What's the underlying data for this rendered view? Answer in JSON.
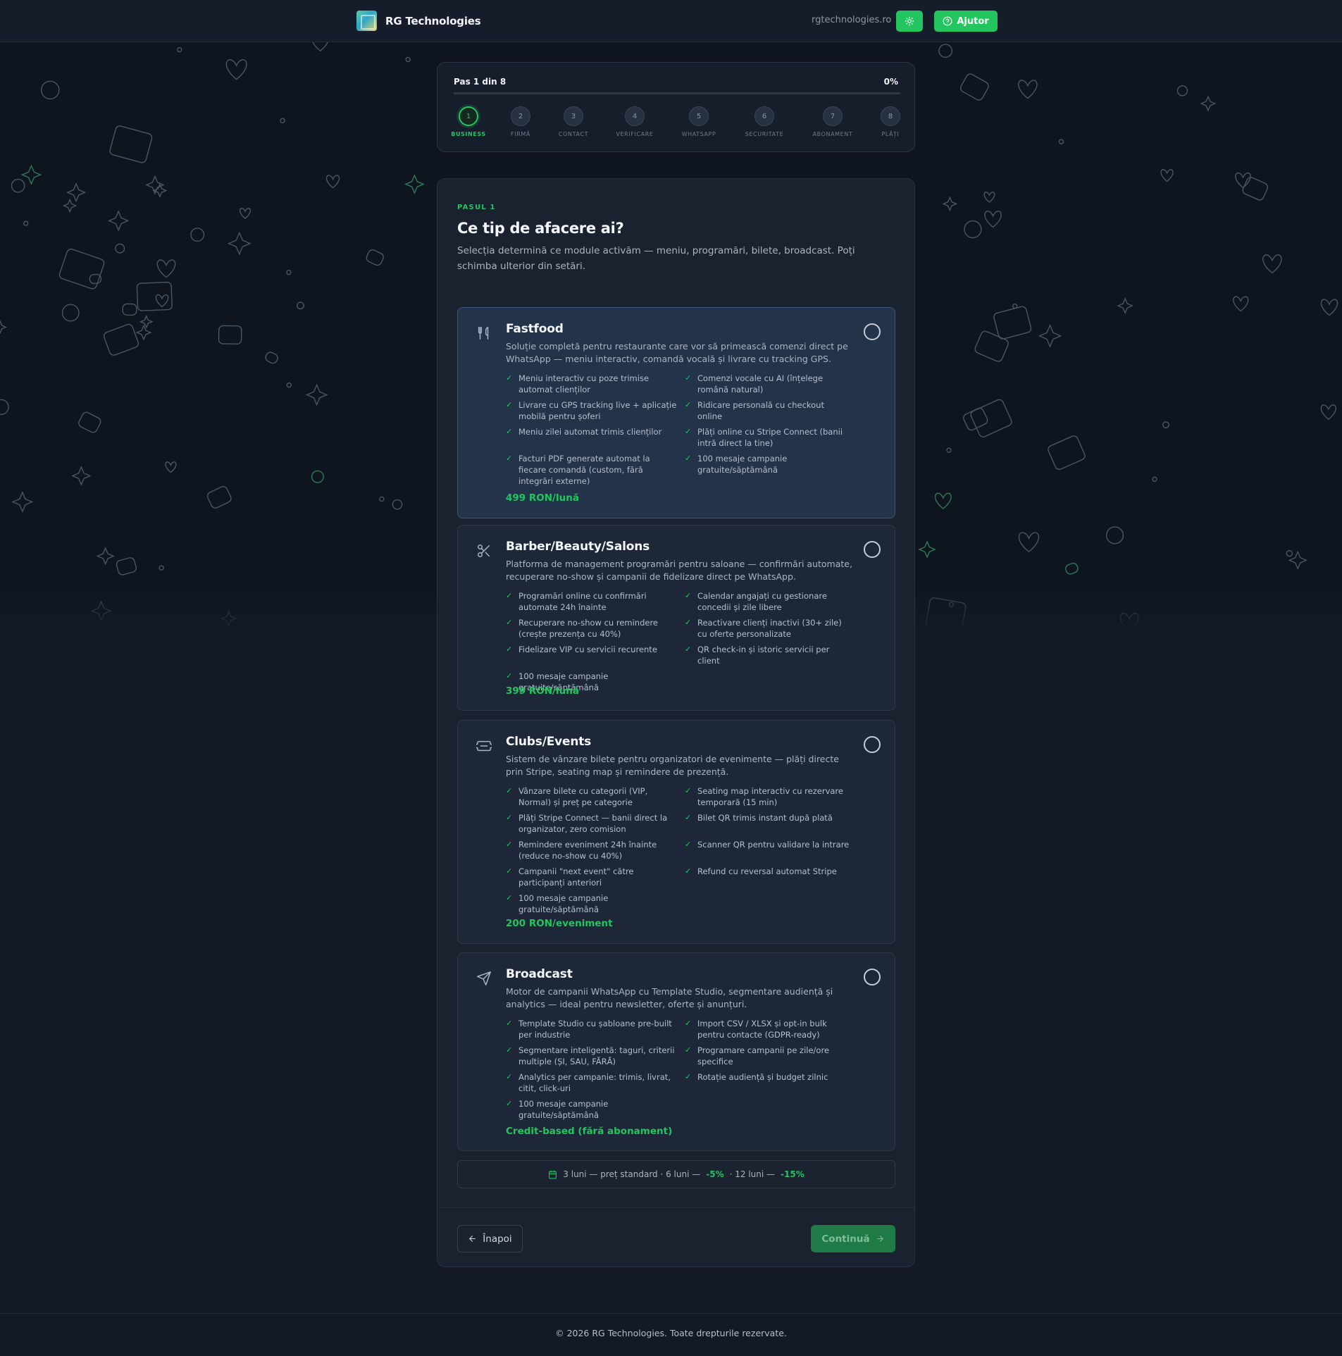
{
  "header": {
    "brand": "RG Technologies",
    "site": "rgtechnologies.ro",
    "help_label": "Ajutor"
  },
  "stepper": {
    "title": "Pas 1 din 8",
    "percent": "0%",
    "progress": 0,
    "steps": [
      {
        "num": "1",
        "label": "BUSINESS",
        "active": true
      },
      {
        "num": "2",
        "label": "FIRMĂ"
      },
      {
        "num": "3",
        "label": "CONTACT"
      },
      {
        "num": "4",
        "label": "VERIFICARE"
      },
      {
        "num": "5",
        "label": "WHATSAPP"
      },
      {
        "num": "6",
        "label": "SECURITATE"
      },
      {
        "num": "7",
        "label": "ABONAMENT"
      },
      {
        "num": "8",
        "label": "PLĂȚI"
      }
    ]
  },
  "main": {
    "eyebrow": "PASUL 1",
    "title": "Ce tip de afacere ai?",
    "subtitle": "Selecția determină ce module activăm — meniu, programări, bilete, broadcast. Poți schimba ulterior din setări.",
    "options": [
      {
        "icon": "utensils-icon",
        "title": "Fastfood",
        "desc": "Soluție completă pentru restaurante care vor să primească comenzi direct pe WhatsApp — meniu interactiv, comandă vocală și livrare cu tracking GPS.",
        "features": [
          "Meniu interactiv cu poze trimise automat clienților",
          "Comenzi vocale cu AI (înțelege română natural)",
          "Livrare cu GPS tracking live + aplicație mobilă pentru șoferi",
          "Ridicare personală cu checkout online",
          "Meniu zilei automat trimis clienților",
          "Plăți online cu Stripe Connect (banii intră direct la tine)",
          "Facturi PDF generate automat la fiecare comandă (custom, fără integrări externe)",
          "100 mesaje campanie gratuite/săptămână"
        ],
        "price": "499 RON/lună"
      },
      {
        "icon": "scissors-icon",
        "title": "Barber/Beauty/Salons",
        "desc": "Platforma de management programări pentru saloane — confirmări automate, recuperare no-show și campanii de fidelizare direct pe WhatsApp.",
        "features": [
          "Programări online cu confirmări automate 24h înainte",
          "Calendar angajați cu gestionare concedii și zile libere",
          "Recuperare no-show cu remindere (crește prezența cu 40%)",
          "Reactivare clienți inactivi (30+ zile) cu oferte personalizate",
          "Fidelizare VIP cu servicii recurente",
          "QR check-in și istoric servicii per client",
          "100 mesaje campanie gratuite/săptămână"
        ],
        "price": "399 RON/lună"
      },
      {
        "icon": "ticket-icon",
        "title": "Clubs/Events",
        "desc": "Sistem de vânzare bilete pentru organizatori de evenimente — plăți directe prin Stripe, seating map și remindere de prezență.",
        "features": [
          "Vânzare bilete cu categorii (VIP, Normal) și preț pe categorie",
          "Seating map interactiv cu rezervare temporară (15 min)",
          "Plăți Stripe Connect — banii direct la organizator, zero comision",
          "Bilet QR trimis instant după plată",
          "Remindere eveniment 24h înainte (reduce no-show cu 40%)",
          "Scanner QR pentru validare la intrare",
          "Campanii \"next event\" către participanți anteriori",
          "Refund cu reversal automat Stripe",
          "100 mesaje campanie gratuite/săptămână"
        ],
        "price": "200 RON/eveniment"
      },
      {
        "icon": "send-icon",
        "title": "Broadcast",
        "desc": "Motor de campanii WhatsApp cu Template Studio, segmentare audiență și analytics — ideal pentru newsletter, oferte și anunțuri.",
        "features": [
          "Template Studio cu șabloane pre-built per industrie",
          "Import CSV / XLSX și opt-in bulk pentru contacte (GDPR-ready)",
          "Segmentare inteligentă: taguri, criterii multiple (ȘI, SAU, FĂRĂ)",
          "Programare campanii pe zile/ore specifice",
          "Analytics per campanie: trimis, livrat, citit, click-uri",
          "Rotație audiență și budget zilnic",
          "100 mesaje campanie gratuite/săptămână"
        ],
        "price": "Credit-based (fără abonament)"
      }
    ],
    "discount": {
      "part1": "3 luni — preț standard · 6 luni —",
      "d6": "-5%",
      "part2": "· 12 luni —",
      "d12": "-15%"
    },
    "back_label": "Înapoi",
    "next_label": "Continuă"
  },
  "footer": {
    "copyright": "© 2026 RG Technologies. Toate drepturile rezervate."
  },
  "colors": {
    "accent": "#22c55e",
    "background": "#131a26",
    "card": "#1a2230",
    "selected": "#233349"
  }
}
